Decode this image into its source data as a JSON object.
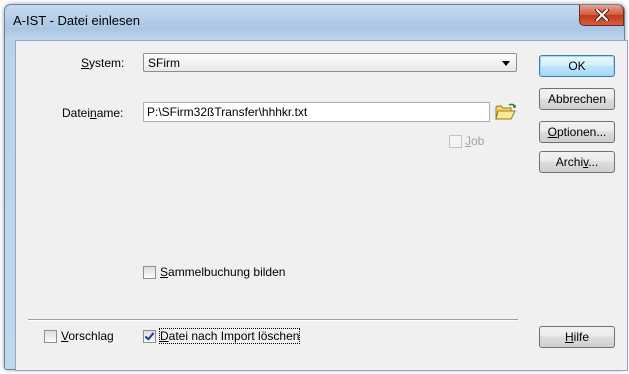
{
  "window": {
    "title": "A-IST - Datei einlesen"
  },
  "system": {
    "label_pre": "",
    "label_u": "S",
    "label_post": "ystem:",
    "selected": "SFirm"
  },
  "dateiname": {
    "label_pre": "Datei",
    "label_u": "n",
    "label_post": "ame:",
    "value": "P:\\SFirm32ßTransfer\\hhhkr.txt"
  },
  "job": {
    "label_u": "J",
    "label_post": "ob",
    "checked": false,
    "enabled": false
  },
  "sammelbuchung": {
    "label_u": "S",
    "label_post": "ammelbuchung bilden",
    "checked": false
  },
  "vorschlag": {
    "label_u": "V",
    "label_post": "orschlag",
    "checked": false
  },
  "datei_loeschen": {
    "label_u": "D",
    "label_post": "atei nach Import löschen",
    "checked": true
  },
  "buttons": {
    "ok": "OK",
    "abbrechen": "Abbrechen",
    "optionen_u": "O",
    "optionen_post": "ptionen...",
    "archiv_pre": "Archi",
    "archiv_u": "v",
    "archiv_post": "...",
    "hilfe_u": "H",
    "hilfe_post": "ilfe"
  },
  "colors": {
    "title_bar": "#b9d1ea",
    "close_button": "#c7482a",
    "dialog_bg": "#f0f0f0",
    "default_button": "#bee6fd"
  }
}
